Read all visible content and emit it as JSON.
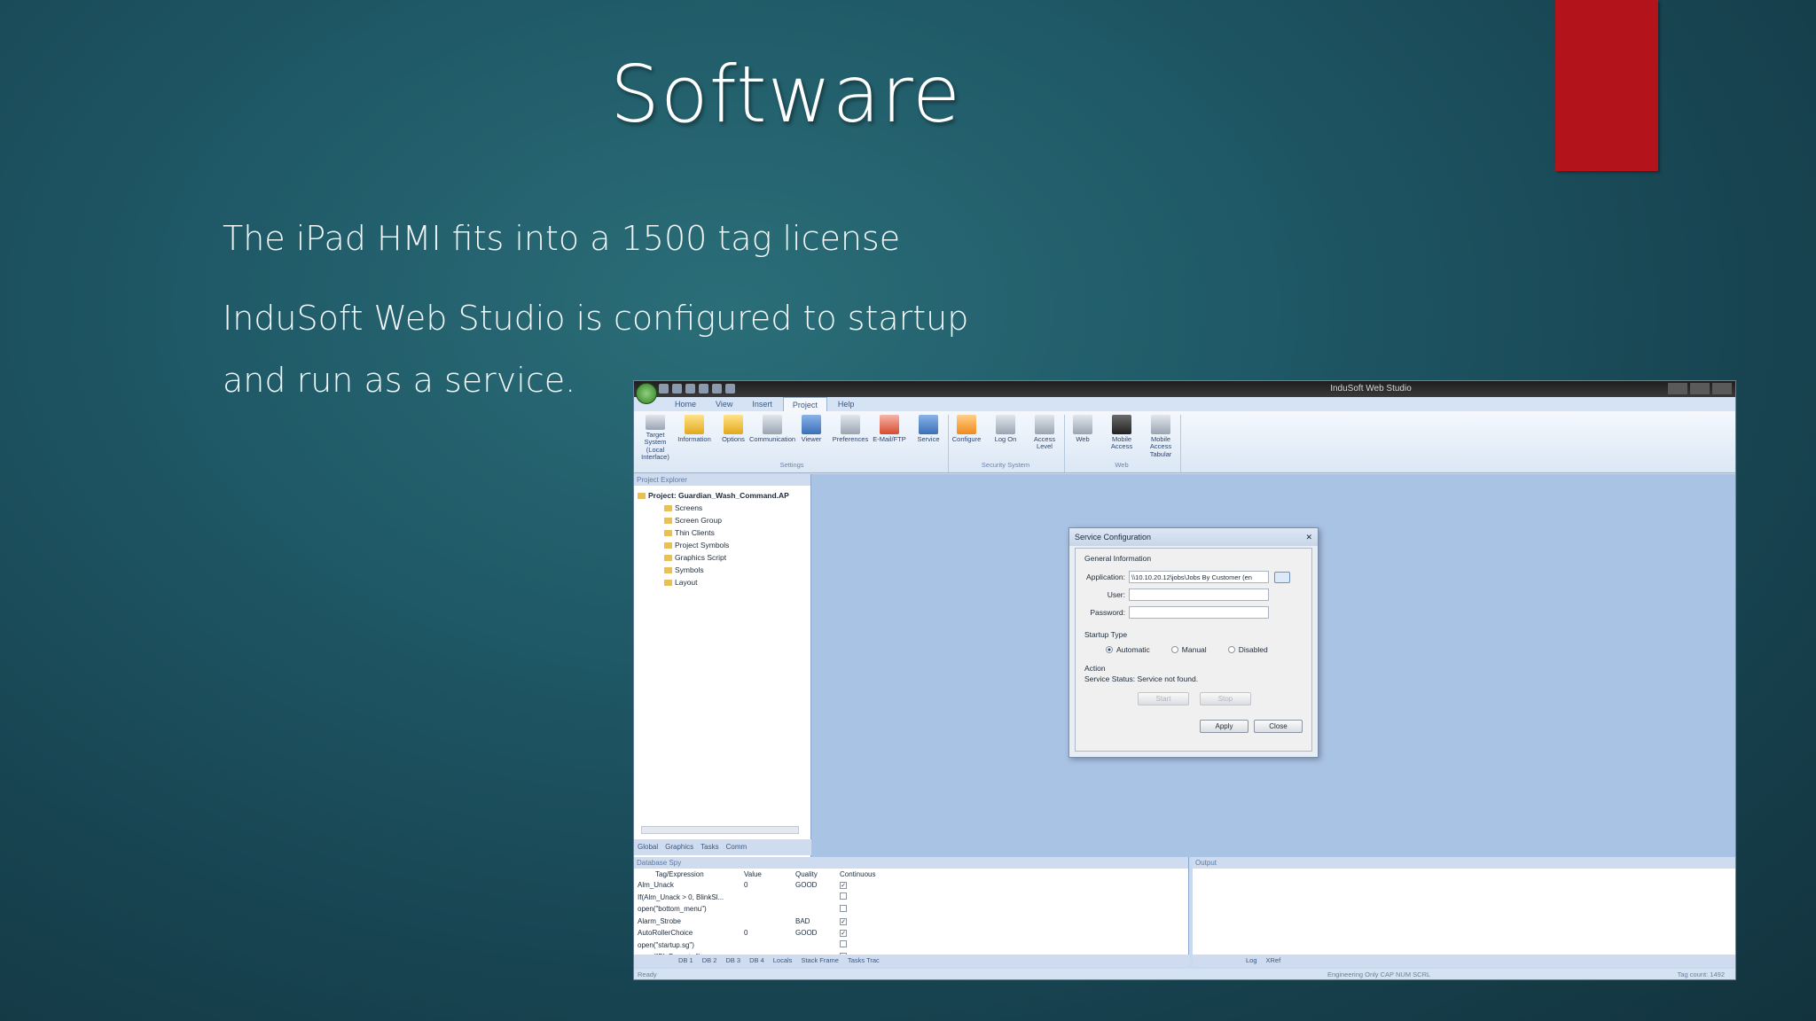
{
  "slide": {
    "title": "Software",
    "bullets": [
      "The iPad HMI fits into a 1500 tag license",
      "InduSoft Web Studio is configured to startup",
      "and run as a service."
    ],
    "accent_color": "#b3141c"
  },
  "app": {
    "window_title": "InduSoft Web Studio",
    "tabs": [
      "Home",
      "View",
      "Insert",
      "Project",
      "Help"
    ],
    "active_tab": "Project",
    "ribbon_groups": [
      {
        "label": "Settings",
        "buttons": [
          "Target System (Local Interface)",
          "Information",
          "Options",
          "Communication",
          "Viewer",
          "Preferences",
          "E-Mail/FTP",
          "Service"
        ]
      },
      {
        "label": "Security System",
        "buttons": [
          "Configure",
          "Log On",
          "Access Level"
        ]
      },
      {
        "label": "Web",
        "buttons": [
          "Web",
          "Mobile Access",
          "Mobile Access Tabular"
        ]
      }
    ],
    "project_explorer": {
      "header": "Project Explorer",
      "root": "Project: Guardian_Wash_Command.AP",
      "items": [
        "Screens",
        "Screen Group",
        "Thin Clients",
        "Project Symbols",
        "Graphics Script",
        "Symbols",
        "Layout"
      ],
      "tabs": [
        "Global",
        "Graphics",
        "Tasks",
        "Comm"
      ]
    },
    "dialog": {
      "title": "Service Configuration",
      "section_general": "General Information",
      "application_label": "Application:",
      "application_value": "\\\\10.10.20.12\\jobs\\Jobs By Customer (en",
      "user_label": "User:",
      "password_label": "Password:",
      "startup_label": "Startup Type",
      "radios": [
        "Automatic",
        "Manual",
        "Disabled"
      ],
      "action_label": "Action",
      "status_label": "Service Status:",
      "status_value": "Service not found.",
      "start": "Start",
      "stop": "Stop",
      "apply": "Apply",
      "close": "Close"
    },
    "database_spy": {
      "header": "Database Spy",
      "columns": [
        "Tag/Expression",
        "Value",
        "Quality",
        "Continuous"
      ],
      "rows": [
        {
          "tag": "Alm_Unack",
          "value": "0",
          "quality": "GOOD",
          "cont": "✓"
        },
        {
          "tag": "If(Alm_Unack > 0, BlinkSl...",
          "value": "",
          "quality": "",
          "cont": ""
        },
        {
          "tag": "open(\"bottom_menu\")",
          "value": "",
          "quality": "",
          "cont": ""
        },
        {
          "tag": "Alarm_Strobe",
          "value": "",
          "quality": "BAD",
          "cont": "✓"
        },
        {
          "tag": "AutoRollerChoice",
          "value": "0",
          "quality": "GOOD",
          "cont": "✓"
        },
        {
          "tag": "open(\"startup.sg\")",
          "value": "",
          "quality": "",
          "cont": ""
        },
        {
          "tag": "open(\"BL Pos.mtw\")",
          "value": "",
          "quality": "",
          "cont": ""
        }
      ],
      "tabs": [
        "DB 1",
        "DB 2",
        "DB 3",
        "DB 4",
        "Locals",
        "Stack Frame",
        "Tasks Trac"
      ]
    },
    "output": {
      "header": "Output",
      "tabs": [
        "Log",
        "XRef"
      ]
    },
    "status": {
      "left": "Ready",
      "mid": "Engineering Only  CAP  NUM  SCRL",
      "right": "Tag count: 1492"
    }
  }
}
